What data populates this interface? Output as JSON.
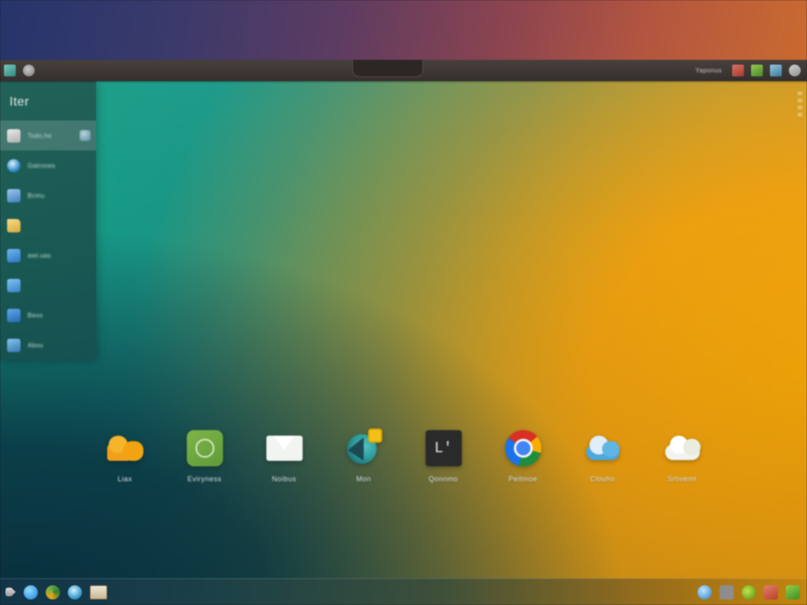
{
  "desktop": {
    "wallpaper_colors": {
      "sky_left": "#26356b",
      "sky_right": "#c96a30",
      "field_teal": "#16a085",
      "field_orange": "#f0a408",
      "field_dark_blue": "#0a3443"
    }
  },
  "top_panel": {
    "background": "#3d3734",
    "left_icons": [
      {
        "name": "app-grid-icon",
        "glyph": "grid"
      },
      {
        "name": "network-icon",
        "glyph": "network"
      }
    ],
    "tray_label": "Yaponus",
    "right_icons": [
      {
        "name": "messaging-icon",
        "glyph": "chat"
      },
      {
        "name": "battery-icon",
        "glyph": "battery"
      },
      {
        "name": "keyboard-icon",
        "glyph": "keyboard"
      },
      {
        "name": "power-icon",
        "glyph": "power"
      }
    ]
  },
  "sidebar": {
    "title": "Iter",
    "background": "#235d54",
    "items": [
      {
        "label": "Todo,he",
        "icon": "calculator-icon",
        "active": true,
        "trailing_icon": "person-icon"
      },
      {
        "label": "Gatrones",
        "icon": "clock-icon",
        "active": false
      },
      {
        "label": "Bcmu",
        "icon": "document-icon",
        "active": false
      },
      {
        "label": "",
        "icon": "folder-icon",
        "active": false
      },
      {
        "label": "awt.uas",
        "icon": "media-icon",
        "active": false
      },
      {
        "label": "",
        "icon": "tool-icon",
        "active": false
      },
      {
        "label": "Bexo",
        "icon": "app-icon",
        "active": false
      },
      {
        "label": "Abou",
        "icon": "settings-icon",
        "active": false
      }
    ]
  },
  "edge_dots": {
    "name": "window-scroll-markers",
    "count": 4
  },
  "dock": {
    "items": [
      {
        "label": "Liax",
        "icon": "orange-cloud-icon"
      },
      {
        "label": "Eviryness",
        "icon": "green-app-icon"
      },
      {
        "label": "Noibus",
        "icon": "mail-envelope-icon"
      },
      {
        "label": "Mon",
        "icon": "sphere-badge-icon"
      },
      {
        "label": "Qonnmo",
        "icon": "terminal-icon"
      },
      {
        "label": "Peitmoe",
        "icon": "chrome-browser-icon"
      },
      {
        "label": "Clouho",
        "icon": "blue-cloud-icon"
      },
      {
        "label": "Srtivemt",
        "icon": "white-cloud-icon"
      }
    ]
  },
  "taskbar": {
    "left_icons": [
      {
        "name": "start-menu-icon",
        "glyph": "menu"
      },
      {
        "name": "blue-sphere-icon",
        "glyph": "sphere"
      },
      {
        "name": "firefox-icon",
        "glyph": "fox"
      },
      {
        "name": "disc-player-icon",
        "glyph": "disc"
      },
      {
        "name": "document-thumbnail-icon",
        "glyph": "doc"
      }
    ],
    "right_icons": [
      {
        "name": "network-tray-icon",
        "glyph": "net"
      },
      {
        "name": "volume-tray-icon",
        "glyph": "volume"
      },
      {
        "name": "update-tray-icon",
        "glyph": "update"
      },
      {
        "name": "archive-tray-icon",
        "glyph": "archive"
      },
      {
        "name": "spreadsheet-tray-icon",
        "glyph": "sheet"
      }
    ]
  }
}
